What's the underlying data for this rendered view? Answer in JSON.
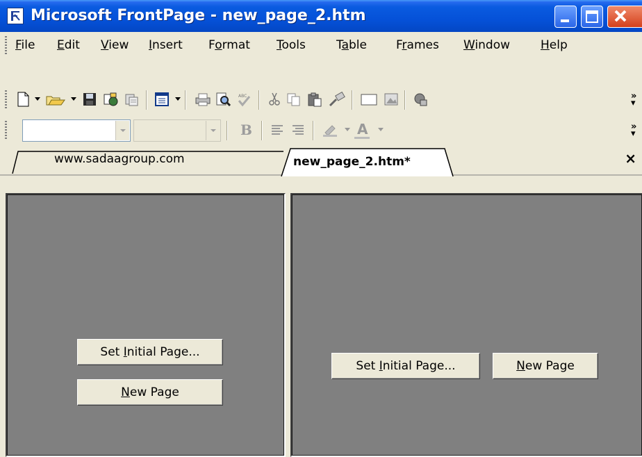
{
  "window": {
    "title": "Microsoft FrontPage - new_page_2.htm",
    "controls": [
      "minimize",
      "maximize",
      "close"
    ]
  },
  "menu": {
    "items": [
      "File",
      "Edit",
      "View",
      "Insert",
      "Format",
      "Tools",
      "Table",
      "Frames",
      "Window",
      "Help"
    ],
    "mnemonics": [
      "F",
      "E",
      "V",
      "I",
      "o",
      "T",
      "a",
      "r",
      "W",
      "H"
    ]
  },
  "toolbar_standard": {
    "icons": [
      "new-page-icon",
      "open-folder-icon",
      "save-icon",
      "publish-icon",
      "folder-list-icon",
      "toggle-pane-icon",
      "print-icon",
      "print-preview-icon",
      "spelling-icon",
      "cut-icon",
      "copy-icon",
      "paste-icon",
      "format-painter-icon",
      "insert-table-icon",
      "insert-picture-icon",
      "web-component-icon"
    ],
    "overflow": "»"
  },
  "toolbar_formatting": {
    "style_value": "",
    "font_value": "",
    "icons": [
      "bold-icon",
      "align-left-icon",
      "align-right-icon",
      "highlight-icon",
      "font-color-icon"
    ],
    "bold_label": "B",
    "font_color_label": "A",
    "overflow": "»"
  },
  "tabs": [
    {
      "label": "www.sadaagroup.com",
      "active": false
    },
    {
      "label": "new_page_2.htm*",
      "active": true
    }
  ],
  "tabs_close": "×",
  "frames": {
    "left": {
      "set_initial_prefix": "Set ",
      "set_initial_mnemonic": "I",
      "set_initial_suffix": "nitial Page...",
      "new_page_mnemonic": "N",
      "new_page_suffix": "ew Page"
    },
    "right": {
      "set_initial_prefix": "Set ",
      "set_initial_mnemonic": "I",
      "set_initial_suffix": "nitial Page...",
      "new_page_mnemonic": "N",
      "new_page_suffix": "ew Page"
    }
  },
  "colors": {
    "titlebar": "#0551d8",
    "frame_fill": "#808080",
    "chrome": "#ece9d8"
  }
}
